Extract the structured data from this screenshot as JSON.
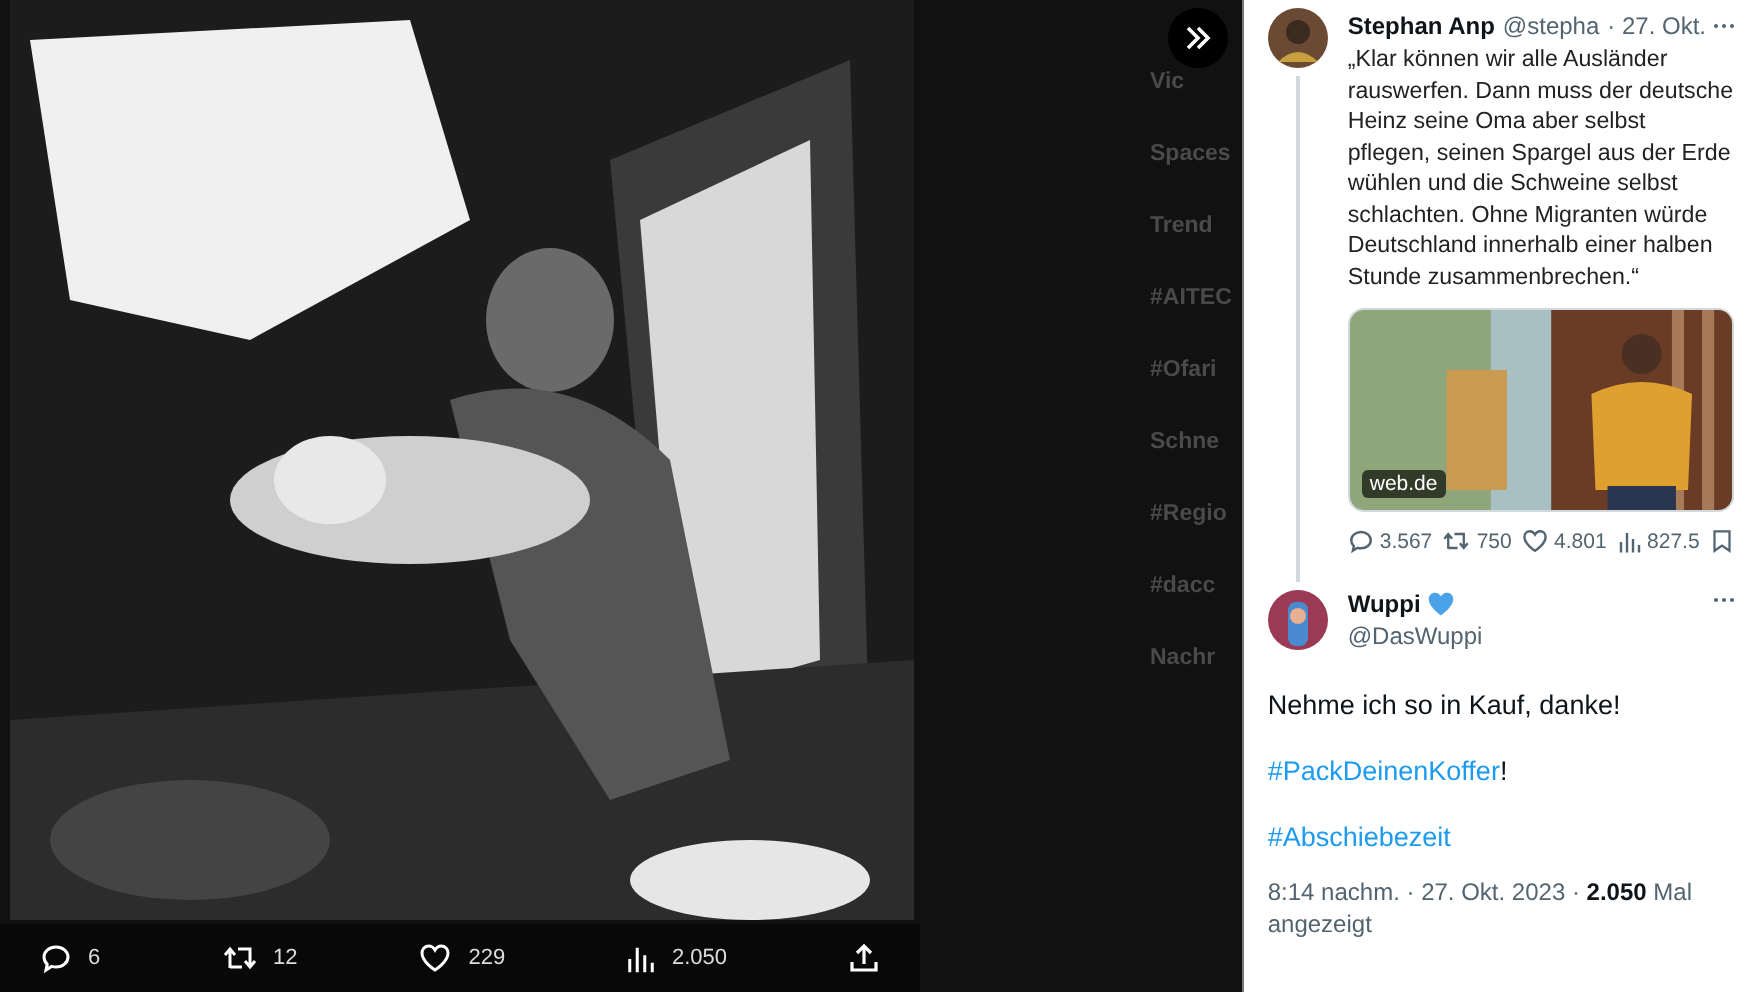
{
  "media": {
    "actions": [
      {
        "kind": "reply",
        "count": "6"
      },
      {
        "kind": "retweet",
        "count": "12"
      },
      {
        "kind": "like",
        "count": "229"
      },
      {
        "kind": "views",
        "count": "2.050"
      },
      {
        "kind": "share"
      }
    ]
  },
  "background": {
    "sidebar_texts": [
      "Vic",
      "Spaces",
      "Trend",
      "#AITEC",
      "#Ofari",
      "Schne",
      "#Regio",
      "#dacc",
      "Nachr"
    ]
  },
  "thread": [
    {
      "name": "Stephan Anp",
      "handle": "@stepha",
      "date": "· 27. Okt.",
      "text": "„Klar können wir alle Ausländer rauswerfen. Dann muss der deutsche Heinz seine Oma aber selbst pflegen, seinen Spargel aus der Erde wühlen und die Schweine selbst schlachten. Ohne Migranten würde Deutschland innerhalb einer halben Stunde zusammenbrechen.“",
      "card": {
        "source": "web.de"
      },
      "stats": [
        {
          "kind": "reply",
          "count": "3.567"
        },
        {
          "kind": "retweet",
          "count": "750"
        },
        {
          "kind": "like",
          "count": "4.801"
        },
        {
          "kind": "views",
          "count": "827.5"
        },
        {
          "kind": "bookmark"
        }
      ]
    }
  ],
  "main_tweet": {
    "name": "Wuppi",
    "verified": true,
    "handle": "@DasWuppi",
    "paragraphs": [
      {
        "kind": "text",
        "text": "Nehme ich so in Kauf, danke!"
      },
      {
        "kind": "hashtag",
        "tag": "#PackDeinenKoffer",
        "after": "!"
      },
      {
        "kind": "hashtag",
        "tag": "#Abschiebezeit"
      }
    ],
    "time": "8:14 nachm. · 27. Okt. 2023 ·",
    "views": "2.050",
    "views_label": "Mal angezeigt"
  }
}
